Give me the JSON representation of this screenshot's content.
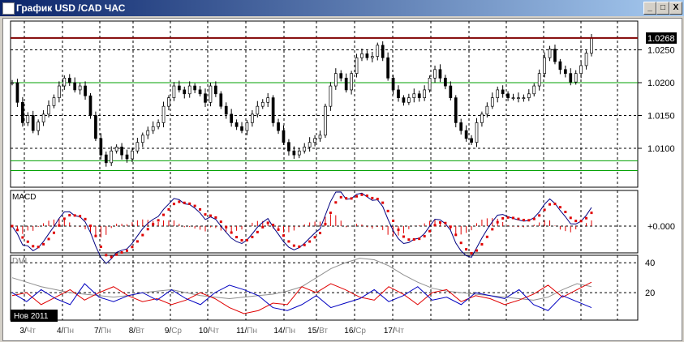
{
  "window": {
    "title": "График USD /CAD  ЧАС",
    "min": "_",
    "max": "□",
    "close": "X"
  },
  "chart_data": {
    "type": "candlestick",
    "symbol": "USD/CAD",
    "timeframe": "ЧАС",
    "price_ticks": [
      "1.0250",
      "1.0200",
      "1.0150",
      "1.0100"
    ],
    "current_price": "1.0268",
    "levels": {
      "resistance": 1.0268,
      "green": [
        1.02,
        1.0081,
        1.0066
      ]
    },
    "ylim": [
      1.005,
      1.029
    ],
    "closes": [
      1.02,
      1.017,
      1.0139,
      1.015,
      1.0127,
      1.014,
      1.0152,
      1.0165,
      1.0177,
      1.0195,
      1.0207,
      1.02,
      1.0189,
      1.0195,
      1.018,
      1.015,
      1.0115,
      1.009,
      1.0078,
      1.0096,
      1.0102,
      1.009,
      1.0084,
      1.0096,
      1.0109,
      1.012,
      1.0127,
      1.0133,
      1.0139,
      1.0164,
      1.0177,
      1.0195,
      1.0189,
      1.0183,
      1.0195,
      1.0189,
      1.0183,
      1.017,
      1.0195,
      1.0183,
      1.0164,
      1.0152,
      1.0139,
      1.0133,
      1.0127,
      1.0139,
      1.0152,
      1.0164,
      1.017,
      1.0177,
      1.0139,
      1.0127,
      1.0109,
      1.0096,
      1.009,
      1.0096,
      1.0102,
      1.0109,
      1.0115,
      1.012,
      1.0164,
      1.0195,
      1.0214,
      1.0207,
      1.0189,
      1.0214,
      1.0238,
      1.0244,
      1.0238,
      1.024,
      1.0257,
      1.0238,
      1.0207,
      1.0189,
      1.0177,
      1.017,
      1.0177,
      1.0183,
      1.0177,
      1.0189,
      1.0207,
      1.022,
      1.0207,
      1.0195,
      1.0177,
      1.0139,
      1.0127,
      1.0115,
      1.0109,
      1.0139,
      1.0152,
      1.0164,
      1.0177,
      1.0189,
      1.0183,
      1.0177,
      1.0177,
      1.0177,
      1.0177,
      1.0183,
      1.0195,
      1.0214,
      1.0238,
      1.0251,
      1.0232,
      1.022,
      1.0214,
      1.0201,
      1.0214,
      1.0226,
      1.0245,
      1.0268
    ],
    "macd": {
      "label": "MACD",
      "zero_label": "+0.000"
    },
    "dmi": {
      "label": "DMI",
      "ticks": [
        "40",
        "20"
      ],
      "ylim": [
        0,
        45
      ],
      "adx": [
        30,
        27,
        24,
        22,
        20,
        19,
        18,
        17,
        18,
        20,
        21,
        22,
        20,
        18,
        17,
        16,
        17,
        18,
        19,
        21,
        24,
        30,
        36,
        40,
        43,
        42,
        38,
        32,
        27,
        23,
        21,
        20,
        19,
        18,
        17,
        16,
        15,
        17,
        22,
        26,
        24
      ],
      "plus_di": [
        18,
        20,
        12,
        17,
        22,
        15,
        20,
        24,
        18,
        14,
        16,
        12,
        15,
        20,
        16,
        10,
        6,
        8,
        13,
        12,
        24,
        20,
        26,
        22,
        17,
        15,
        24,
        19,
        12,
        20,
        22,
        14,
        18,
        16,
        12,
        15,
        19,
        25,
        17,
        22,
        27
      ],
      "minus_di": [
        20,
        14,
        22,
        16,
        12,
        26,
        17,
        14,
        18,
        20,
        15,
        22,
        16,
        12,
        20,
        25,
        22,
        18,
        10,
        8,
        12,
        18,
        10,
        13,
        16,
        22,
        14,
        18,
        24,
        15,
        17,
        12,
        20,
        18,
        16,
        22,
        12,
        8,
        18,
        14,
        10
      ]
    },
    "x_labels": [
      {
        "d": "3/",
        "w": "Чт"
      },
      {
        "d": "4/",
        "w": "Пн"
      },
      {
        "d": "7/",
        "w": "Пн"
      },
      {
        "d": "8/",
        "w": "Вт"
      },
      {
        "d": "9/",
        "w": "Ср"
      },
      {
        "d": "10/",
        "w": "Чт"
      },
      {
        "d": "11/",
        "w": "Пн"
      },
      {
        "d": "14/",
        "w": "Пн"
      },
      {
        "d": "15/",
        "w": "Вт"
      },
      {
        "d": "16/",
        "w": "Ср"
      },
      {
        "d": "17/",
        "w": "Чт"
      }
    ],
    "period_label": "Нов 2011"
  },
  "colors": {
    "resistance": "#800000",
    "green": "#00a000",
    "macd_red": "#e00000",
    "adx": "#909090",
    "plus": "#e00000",
    "minus": "#0000c0"
  }
}
